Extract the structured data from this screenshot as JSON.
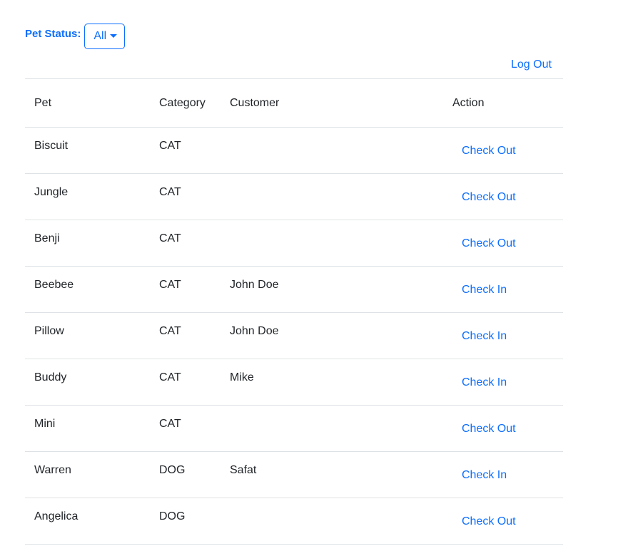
{
  "filter": {
    "label": "Pet Status:",
    "selected": "All"
  },
  "header": {
    "logout": "Log Out"
  },
  "table": {
    "columns": [
      "Pet",
      "Category",
      "Customer",
      "Action"
    ],
    "rows": [
      {
        "pet": "Biscuit",
        "category": "CAT",
        "customer": "",
        "action": "Check Out"
      },
      {
        "pet": "Jungle",
        "category": "CAT",
        "customer": "",
        "action": "Check Out"
      },
      {
        "pet": "Benji",
        "category": "CAT",
        "customer": "",
        "action": "Check Out"
      },
      {
        "pet": "Beebee",
        "category": "CAT",
        "customer": "John Doe",
        "action": "Check In"
      },
      {
        "pet": "Pillow",
        "category": "CAT",
        "customer": "John Doe",
        "action": "Check In"
      },
      {
        "pet": "Buddy",
        "category": "CAT",
        "customer": "Mike",
        "action": "Check In"
      },
      {
        "pet": "Mini",
        "category": "CAT",
        "customer": "",
        "action": "Check Out"
      },
      {
        "pet": "Warren",
        "category": "DOG",
        "customer": "Safat",
        "action": "Check In"
      },
      {
        "pet": "Angelica",
        "category": "DOG",
        "customer": "",
        "action": "Check Out"
      }
    ]
  },
  "colors": {
    "accent": "#0d6efd",
    "border": "#dee2e6",
    "text": "#212529"
  }
}
